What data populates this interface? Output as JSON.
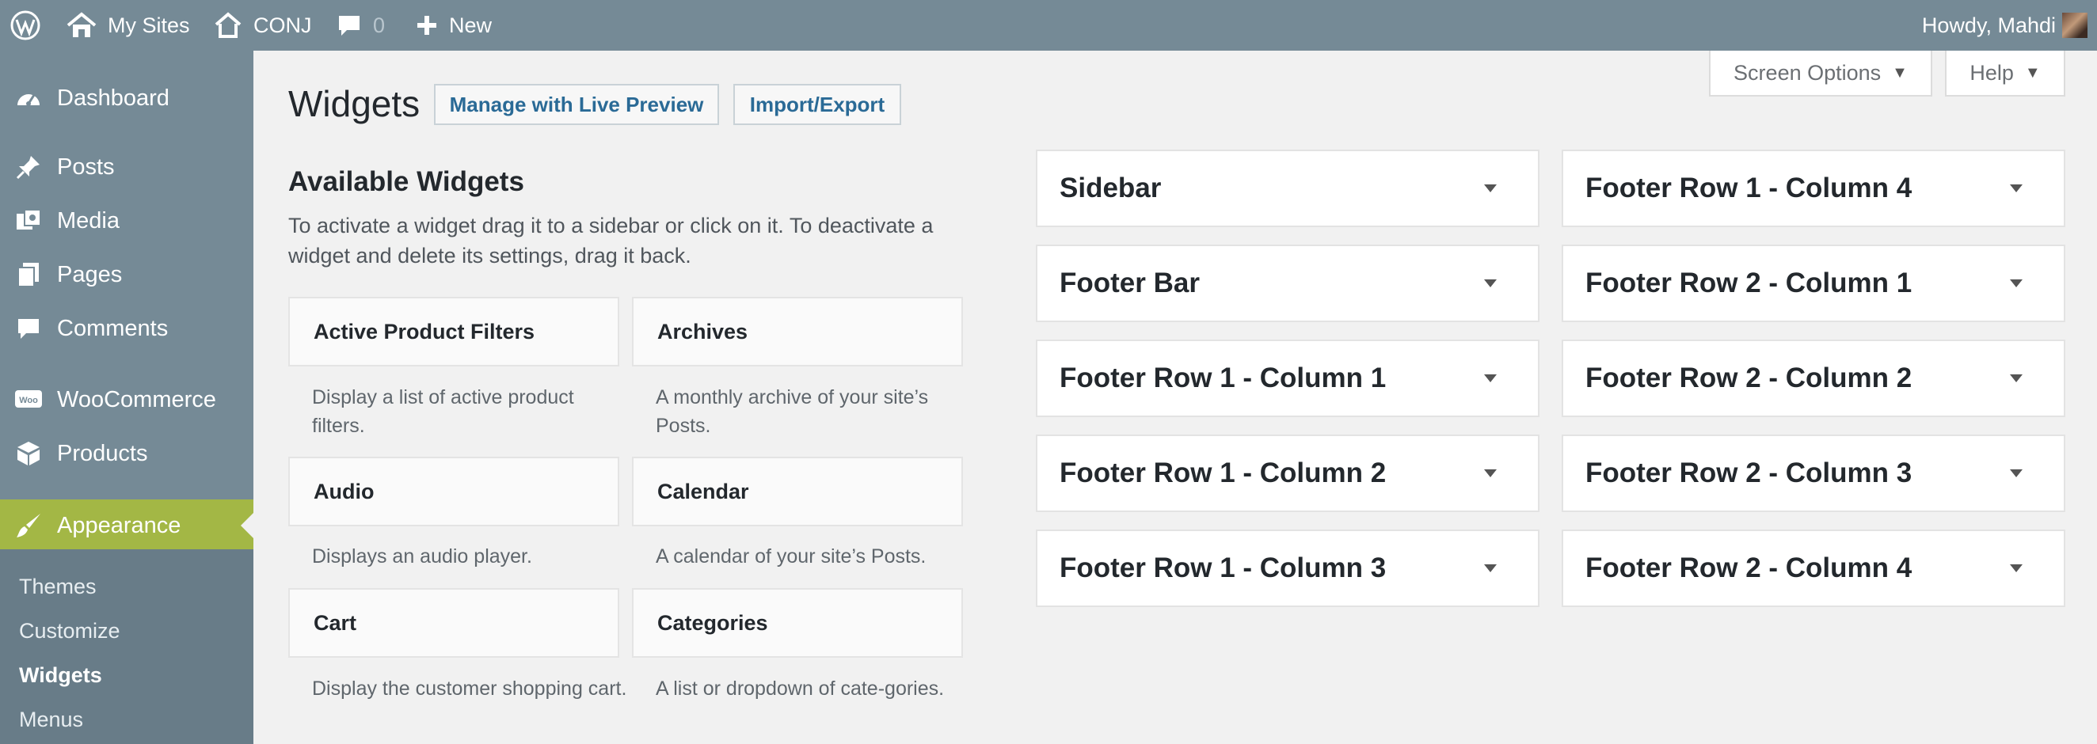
{
  "topbar": {
    "my_sites": "My Sites",
    "site_name": "CONJ",
    "comment_count": "0",
    "new_label": "New",
    "howdy": "Howdy, Mahdi",
    "icons": [
      "wordpress-logo-icon",
      "my-sites-icon",
      "home-icon",
      "comment-bubble-icon",
      "plus-icon",
      "avatar"
    ]
  },
  "sidebar": {
    "items": [
      {
        "label": "Dashboard",
        "icon": "dashboard-icon"
      },
      {
        "label": "Posts",
        "icon": "pin-icon"
      },
      {
        "label": "Media",
        "icon": "media-icon"
      },
      {
        "label": "Pages",
        "icon": "pages-icon"
      },
      {
        "label": "Comments",
        "icon": "comment-icon"
      },
      {
        "label": "WooCommerce",
        "icon": "woo-icon"
      },
      {
        "label": "Products",
        "icon": "products-icon"
      },
      {
        "label": "Appearance",
        "icon": "brush-icon"
      }
    ],
    "submenu": [
      "Themes",
      "Customize",
      "Widgets",
      "Menus"
    ],
    "current_submenu": "Widgets"
  },
  "header": {
    "title": "Widgets",
    "live_preview_button": "Manage with Live Preview",
    "import_export_button": "Import/Export",
    "screen_options": "Screen Options",
    "help": "Help"
  },
  "available": {
    "heading": "Available Widgets",
    "description": "To activate a widget drag it to a sidebar or click on it. To deactivate a widget and delete its settings, drag it back.",
    "widgets": [
      {
        "title": "Active Product Filters",
        "desc": "Display a list of active product filters."
      },
      {
        "title": "Archives",
        "desc": "A monthly archive of your site’s Posts."
      },
      {
        "title": "Audio",
        "desc": "Displays an audio player."
      },
      {
        "title": "Calendar",
        "desc": "A calendar of your site’s Posts."
      },
      {
        "title": "Cart",
        "desc": "Display the customer shopping cart."
      },
      {
        "title": "Categories",
        "desc": "A list or dropdown of cate-gories."
      }
    ]
  },
  "sidebars": {
    "left": [
      "Sidebar",
      "Footer Bar",
      "Footer Row 1 - Column 1",
      "Footer Row 1 - Column 2",
      "Footer Row 1 - Column 3"
    ],
    "right": [
      "Footer Row 1 - Column 4",
      "Footer Row 2 - Column 1",
      "Footer Row 2 - Column 2",
      "Footer Row 2 - Column 3",
      "Footer Row 2 - Column 4"
    ]
  },
  "colors": {
    "admin_bar": "#758a96",
    "menu_highlight": "#a3b745",
    "link": "#2a6a96",
    "background": "#f1f1f1"
  }
}
